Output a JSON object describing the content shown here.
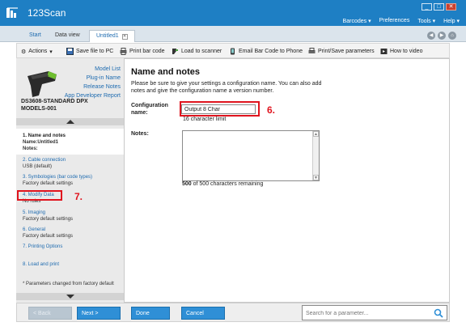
{
  "app": {
    "title": "123Scan"
  },
  "menus": [
    "Barcodes ▾",
    "Preferences",
    "Tools ▾",
    "Help ▾"
  ],
  "tabs": {
    "start": "Start",
    "data_view": "Data view",
    "current": "Untitled1"
  },
  "toolbar": {
    "actions": "Actions",
    "save_file": "Save file to PC",
    "print_barcode": "Print bar code",
    "load_scanner": "Load to scanner",
    "email_barcode": "Email Bar Code to Phone",
    "print_save_params": "Print/Save parameters",
    "how_to_video": "How to video"
  },
  "sidebar": {
    "links": [
      "Model List",
      "Plug-in Name",
      "Release Notes",
      "App Developer Report"
    ],
    "device_model": "DS3608-STANDARD DPX",
    "device_model2": "MODELS-001",
    "steps": [
      {
        "title": "1.  Name and notes",
        "values": [
          "Name:Untitled1",
          "Notes:"
        ]
      },
      {
        "title": "2.  Cable connection",
        "values": [
          "USB (default)"
        ]
      },
      {
        "title": "3.  Symbologies (bar code types)",
        "values": [
          "Factory default settings"
        ]
      },
      {
        "title": "4.  Modify Data",
        "values": [
          "No rules"
        ]
      },
      {
        "title": "5.  Imaging",
        "values": [
          "Factory default settings"
        ]
      },
      {
        "title": "6.  General",
        "values": [
          "Factory default settings"
        ]
      },
      {
        "title": "7.  Printing Options",
        "values": []
      },
      {
        "title": "8.  Load and print",
        "values": []
      }
    ],
    "legend": "Parameters changed from factory default"
  },
  "content": {
    "title": "Name and notes",
    "description": "Please be sure to give your settings a configuration name. You can also add notes and give the configuration name a version number.",
    "config_label": "Configuration name:",
    "config_value": "Output 8 Char",
    "char_limit": "16 character limit",
    "notes_label": "Notes:",
    "notes_value": "",
    "remaining_count": "500",
    "remaining_text": " of 500 characters remaining"
  },
  "annotations": {
    "marker6": "6.",
    "marker7": "7."
  },
  "buttons": {
    "back": "< Back",
    "next": "Next >",
    "done": "Done",
    "cancel": "Cancel"
  },
  "search": {
    "placeholder": "Search for a parameter..."
  },
  "colors": {
    "titlebar": "#1e7fc4",
    "accent": "#2f8fd6",
    "highlight": "#e0141e"
  }
}
